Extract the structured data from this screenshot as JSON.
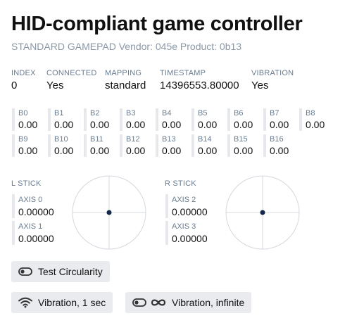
{
  "header": {
    "title": "HID-compliant game controller",
    "subtitle": "STANDARD GAMEPAD Vendor: 045e Product: 0b13"
  },
  "info": {
    "index_label": "INDEX",
    "index_value": "0",
    "connected_label": "CONNECTED",
    "connected_value": "Yes",
    "mapping_label": "MAPPING",
    "mapping_value": "standard",
    "timestamp_label": "TIMESTAMP",
    "timestamp_value": "14396553.80000",
    "vibration_label": "VIBRATION",
    "vibration_value": "Yes"
  },
  "buttons": [
    {
      "label": "B0",
      "value": "0.00"
    },
    {
      "label": "B1",
      "value": "0.00"
    },
    {
      "label": "B2",
      "value": "0.00"
    },
    {
      "label": "B3",
      "value": "0.00"
    },
    {
      "label": "B4",
      "value": "0.00"
    },
    {
      "label": "B5",
      "value": "0.00"
    },
    {
      "label": "B6",
      "value": "0.00"
    },
    {
      "label": "B7",
      "value": "0.00"
    },
    {
      "label": "B8",
      "value": "0.00"
    },
    {
      "label": "B9",
      "value": "0.00"
    },
    {
      "label": "B10",
      "value": "0.00"
    },
    {
      "label": "B11",
      "value": "0.00"
    },
    {
      "label": "B12",
      "value": "0.00"
    },
    {
      "label": "B13",
      "value": "0.00"
    },
    {
      "label": "B14",
      "value": "0.00"
    },
    {
      "label": "B15",
      "value": "0.00"
    },
    {
      "label": "B16",
      "value": "0.00"
    }
  ],
  "left_stick": {
    "label": "L STICK",
    "axis_x_label": "AXIS 0",
    "axis_x_value": "0.00000",
    "axis_y_label": "AXIS 1",
    "axis_y_value": "0.00000",
    "x": 0,
    "y": 0
  },
  "right_stick": {
    "label": "R STICK",
    "axis_x_label": "AXIS 2",
    "axis_x_value": "0.00000",
    "axis_y_label": "AXIS 3",
    "axis_y_value": "0.00000",
    "x": 0,
    "y": 0
  },
  "actions": {
    "test_circularity": "Test Circularity",
    "vibration_1sec": "Vibration, 1 sec",
    "vibration_infinite": "Vibration, infinite"
  },
  "icons": {
    "test_circularity": "toggle-icon",
    "vibration_1sec": "wifi-icon",
    "vibration_infinite": "toggle-icon, infinity-icon"
  },
  "colors": {
    "dot": "#13284b",
    "label": "#6a7c90",
    "button_bg": "#e9ebee"
  }
}
